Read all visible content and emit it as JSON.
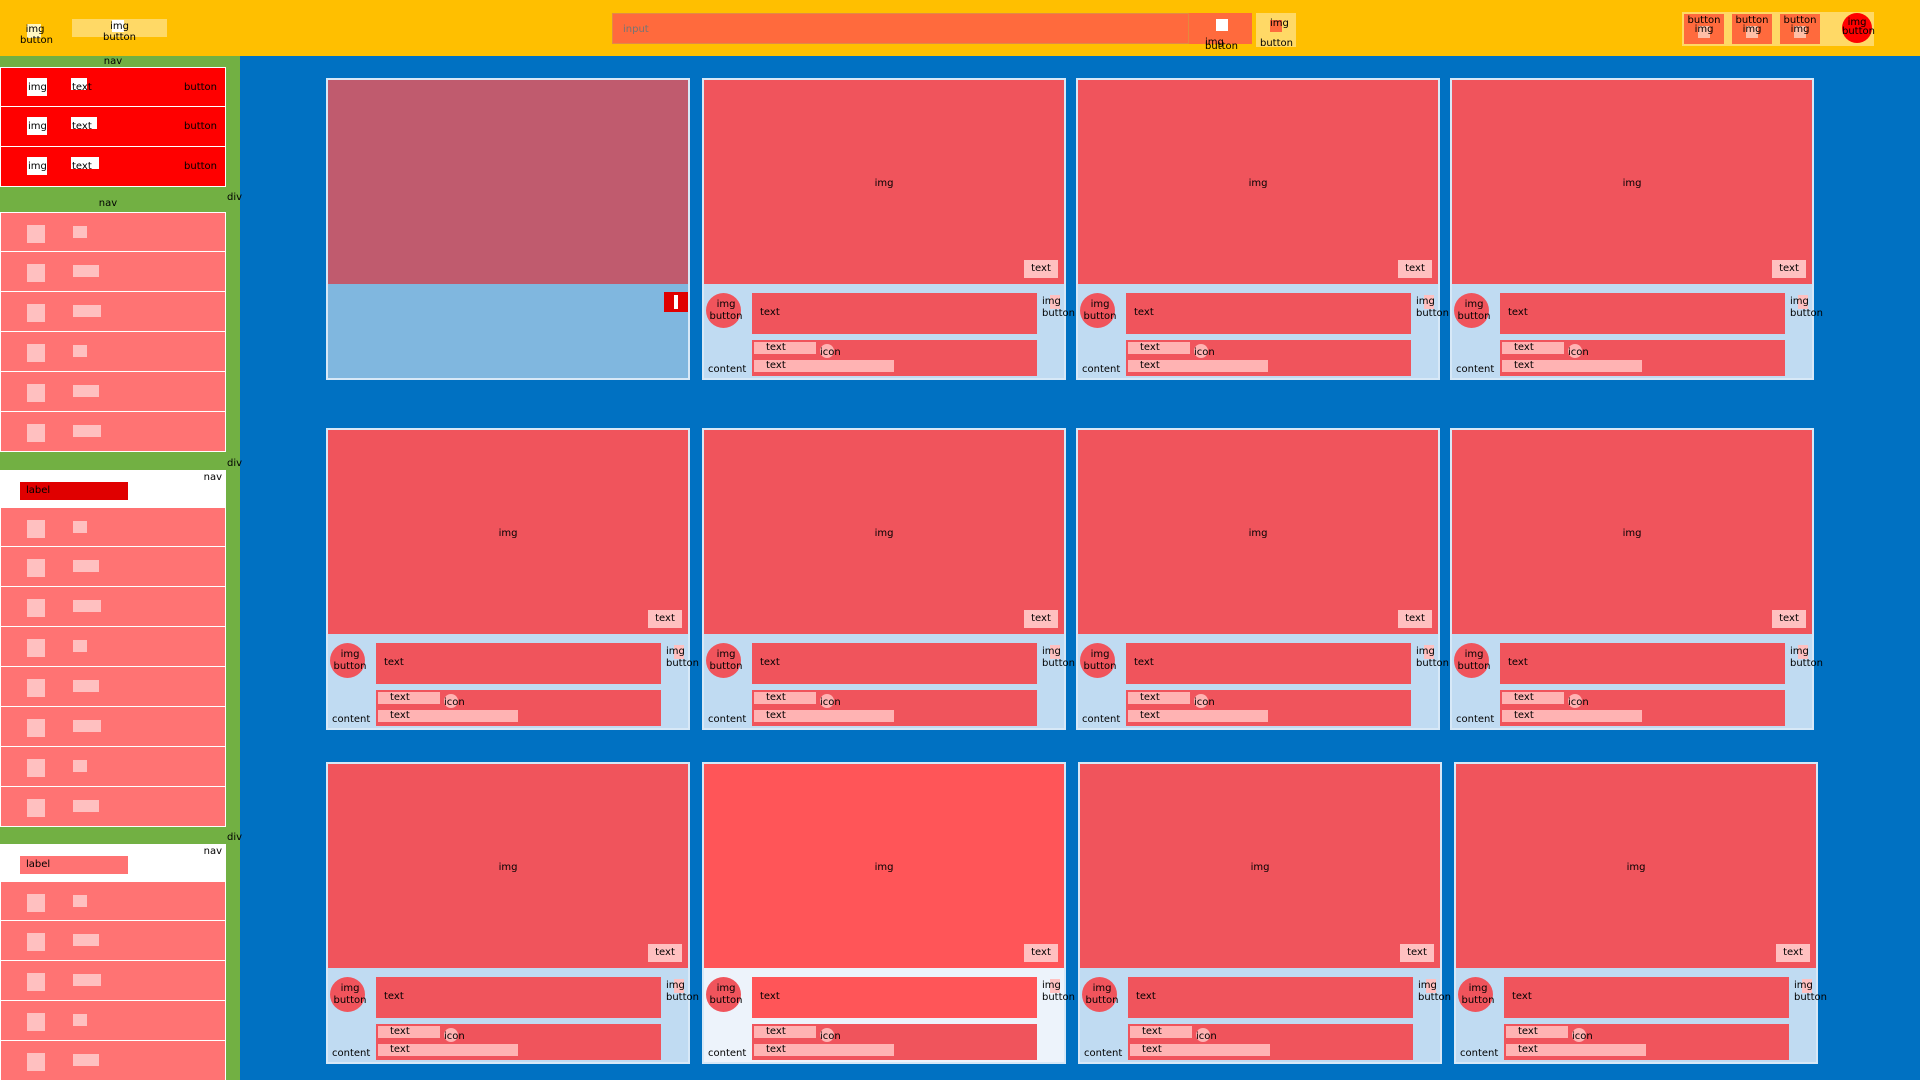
{
  "topbar": {
    "logo": {
      "img_label": "img",
      "button_label": "button"
    },
    "pill": {
      "img_label": "img",
      "button_label": "button"
    },
    "search": {
      "placeholder": "input",
      "button_img": "img",
      "button_label": "button"
    },
    "voice": {
      "img_label": "img",
      "button_label": "button"
    },
    "right_buttons": [
      {
        "button_label": "button",
        "img_label": "img"
      },
      {
        "button_label": "button",
        "img_label": "img"
      },
      {
        "button_label": "button",
        "img_label": "img"
      }
    ],
    "avatar": {
      "img_label": "img",
      "button_label": "button"
    }
  },
  "sidebar": {
    "nav_label": "nav",
    "div_label": "div",
    "primary_rows": [
      {
        "img": "img",
        "text": "text",
        "button": "button"
      },
      {
        "img": "img",
        "text": "text",
        "button": "button"
      },
      {
        "img": "img",
        "text": "text",
        "button": "button"
      }
    ],
    "label1": "label",
    "label2": "label"
  },
  "cards": {
    "img": "img",
    "text": "text",
    "icon": "icon",
    "button": "button",
    "content": "content"
  }
}
